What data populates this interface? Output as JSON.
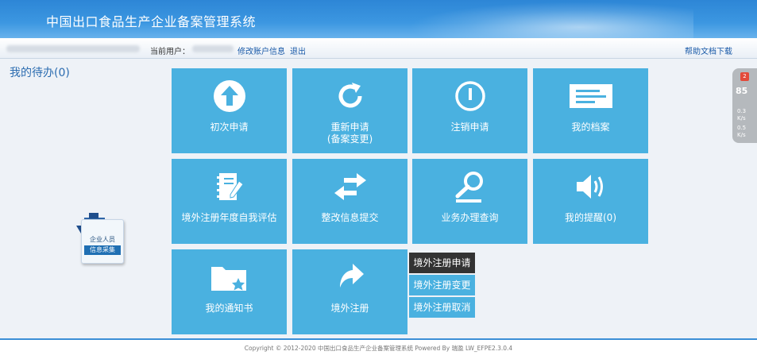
{
  "header": {
    "title": "中国出口食品生产企业备案管理系统"
  },
  "userbar": {
    "current_user_label": "当前用户：",
    "edit_account": "修改账户信息",
    "logout": "退出",
    "help_download": "帮助文档下载"
  },
  "todo": {
    "label": "我的待办(0)"
  },
  "tiles": [
    {
      "label": "初次申请",
      "icon": "upload-arrow-icon"
    },
    {
      "label": "重新申请\n(备案变更)",
      "icon": "refresh-icon"
    },
    {
      "label": "注销申请",
      "icon": "cancel-power-icon"
    },
    {
      "label": "我的档案",
      "icon": "archive-icon"
    },
    {
      "label": "境外注册年度自我评估",
      "icon": "notebook-icon"
    },
    {
      "label": "整改信息提交",
      "icon": "swap-arrows-icon"
    },
    {
      "label": "业务办理查询",
      "icon": "magnifier-icon"
    },
    {
      "label": "我的提醒(0)",
      "icon": "speaker-icon"
    },
    {
      "label": "我的通知书",
      "icon": "folder-star-icon"
    },
    {
      "label": "境外注册",
      "icon": "share-arrow-icon"
    }
  ],
  "submenu": {
    "items": [
      "境外注册申请",
      "境外注册变更",
      "境外注册取消"
    ],
    "active_color": "#333333",
    "item_color": "#4ab1e0"
  },
  "collect_badge": {
    "line1": "企业人员",
    "line2": "信息采集"
  },
  "side_widget": {
    "badge": "2",
    "score": "85",
    "up": "0.3",
    "down": "0.5",
    "unit": "K/s"
  },
  "footer": {
    "copyright": "Copyright © 2012-2020 中国出口食品生产企业备案管理系统 Powered By 瑞盈 LW_EFPE2.3.0.4"
  },
  "colors": {
    "tile": "#4ab1e0",
    "header": "#2d86d6",
    "link": "#1a5aa8"
  }
}
